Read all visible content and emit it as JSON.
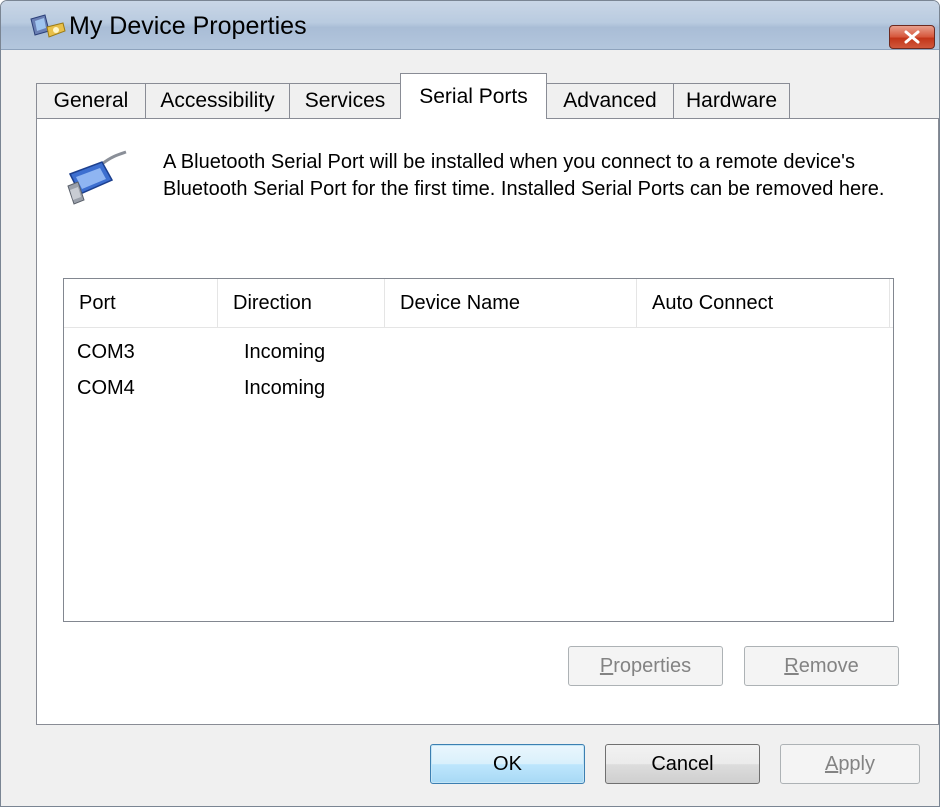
{
  "window": {
    "title": "My Device Properties",
    "icon": "bluetooth-device-icon",
    "close_icon": "close-icon"
  },
  "tabs": [
    {
      "label": "General",
      "active": false
    },
    {
      "label": "Accessibility",
      "active": false
    },
    {
      "label": "Services",
      "active": false
    },
    {
      "label": "Serial Ports",
      "active": true
    },
    {
      "label": "Advanced",
      "active": false
    },
    {
      "label": "Hardware",
      "active": false
    }
  ],
  "description": "A Bluetooth Serial Port will be installed when you connect to a remote device's Bluetooth Serial Port for the first time. Installed Serial Ports can be removed here.",
  "serial_icon": "serial-port-icon",
  "ports_list": {
    "columns": [
      "Port",
      "Direction",
      "Device Name",
      "Auto Connect"
    ],
    "rows": [
      {
        "port": "COM3",
        "direction": "Incoming",
        "device_name": "",
        "auto_connect": ""
      },
      {
        "port": "COM4",
        "direction": "Incoming",
        "device_name": "",
        "auto_connect": ""
      }
    ]
  },
  "panel_buttons": {
    "properties": {
      "accel": "P",
      "rest": "roperties",
      "enabled": false
    },
    "remove": {
      "accel": "R",
      "rest": "emove",
      "enabled": false
    }
  },
  "dialog_buttons": {
    "ok": "OK",
    "cancel": "Cancel",
    "apply": {
      "accel": "A",
      "rest": "pply",
      "enabled": false
    }
  }
}
